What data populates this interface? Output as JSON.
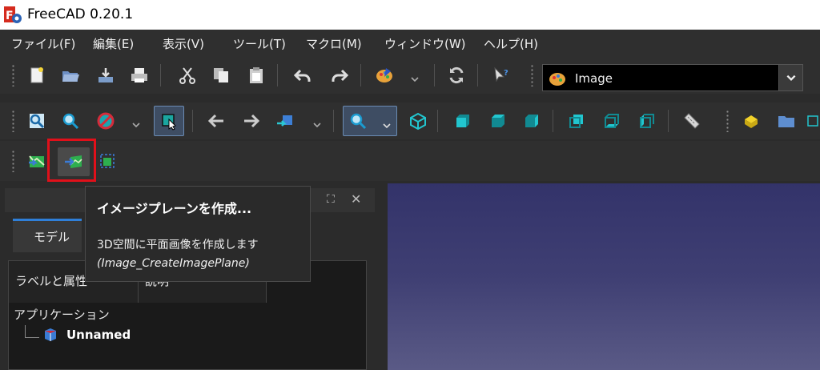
{
  "window": {
    "title": "FreeCAD 0.20.1",
    "app_icon": "freecad-logo-icon"
  },
  "menubar": {
    "items": [
      {
        "label": "ファイル(F)"
      },
      {
        "label": "編集(E)"
      },
      {
        "label": "表示(V)"
      },
      {
        "label": "ツール(T)"
      },
      {
        "label": "マクロ(M)"
      },
      {
        "label": "ウィンドウ(W)"
      },
      {
        "label": "ヘルプ(H)"
      }
    ]
  },
  "workbench_selector": {
    "value": "Image",
    "icon": "image-workbench-icon"
  },
  "toolbars": {
    "file": [
      "new-document-icon",
      "open-icon",
      "save-icon",
      "print-icon"
    ],
    "edit": [
      "cut-icon",
      "copy-icon",
      "paste-icon",
      "undo-icon",
      "redo-icon",
      "workbench-palette-icon",
      "refresh-icon",
      "whats-this-icon"
    ],
    "view": [
      "fit-all-icon",
      "fit-selection-icon",
      "draw-style-icon",
      "bounding-box-icon",
      "back-icon",
      "forward-icon",
      "sync-view-icon",
      "zoom-icon",
      "isometric-view-icon",
      "front-view-icon",
      "top-view-icon",
      "right-view-icon",
      "rear-view-icon",
      "bottom-view-icon",
      "left-view-icon",
      "measure-icon",
      "part-icon",
      "group-icon"
    ],
    "image": [
      "open-image-icon",
      "create-image-plane-icon",
      "image-scaling-icon"
    ]
  },
  "highlight": {
    "target": "create-image-plane-button",
    "color": "#e0101a"
  },
  "tooltip": {
    "title": "イメージプレーンを作成...",
    "description": "3D空間に平面画像を作成します",
    "command": "(Image_CreateImagePlane)"
  },
  "combo_view": {
    "tab": "モデル",
    "columns": [
      "ラベルと属性",
      "説明"
    ],
    "tree": {
      "root_label": "アプリケーション",
      "document": "Unnamed"
    }
  },
  "colors": {
    "accent_tab": "#2f7fd8",
    "viewport_top": "#33336a",
    "viewport_bottom": "#5a5a86"
  }
}
